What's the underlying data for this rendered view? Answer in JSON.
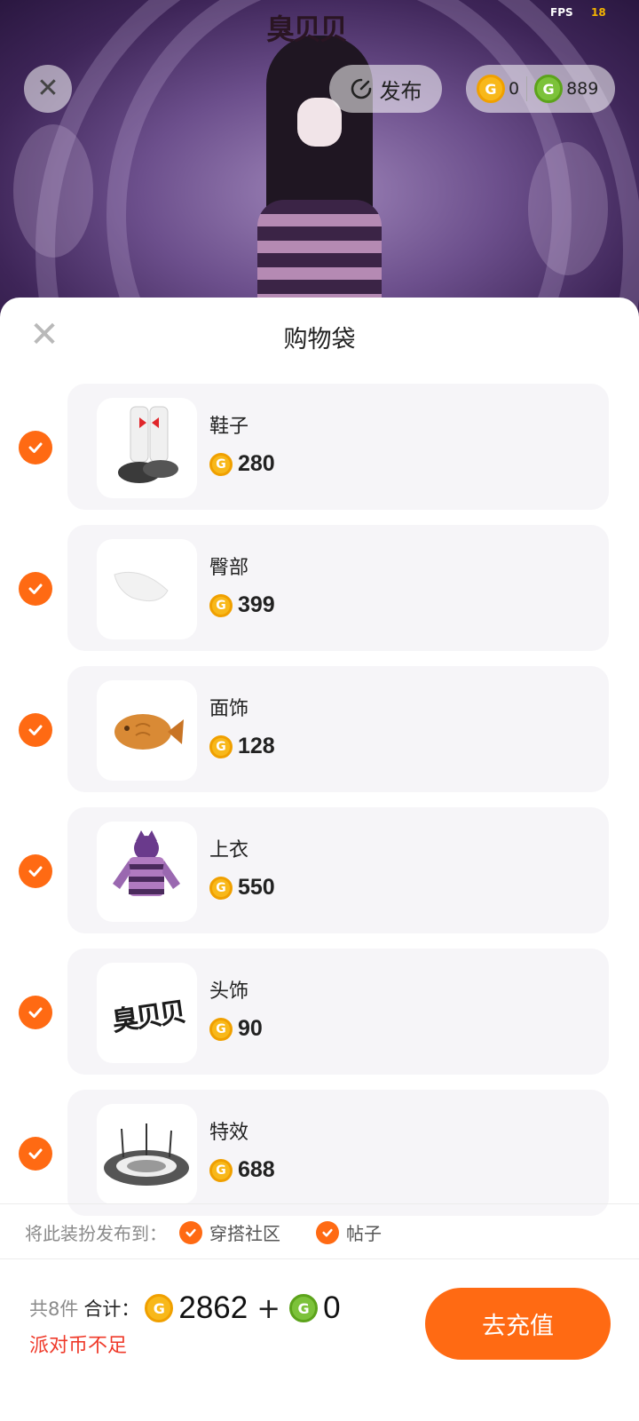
{
  "scene": {
    "logo_text": "臭贝贝",
    "fps_label": "FPS",
    "fps_value": "18"
  },
  "top_bar": {
    "publish_label": "发布",
    "gold_balance": "0",
    "green_balance": "889"
  },
  "sheet": {
    "title": "购物袋",
    "items": [
      {
        "name": "鞋子",
        "price": "280",
        "thumb": "shoes-thumb",
        "checked": true
      },
      {
        "name": "臀部",
        "price": "399",
        "thumb": "hip-thumb",
        "checked": true
      },
      {
        "name": "面饰",
        "price": "128",
        "thumb": "taiyaki-thumb",
        "checked": true
      },
      {
        "name": "上衣",
        "price": "550",
        "thumb": "jacket-thumb",
        "checked": true
      },
      {
        "name": "头饰",
        "price": "90",
        "thumb": "text-headwear-thumb",
        "checked": true
      },
      {
        "name": "特效",
        "price": "688",
        "thumb": "effect-thumb",
        "checked": true
      }
    ],
    "publish_to_label": "将此装扮发布到：",
    "publish_options": [
      "穿搭社区",
      "帖子"
    ]
  },
  "footer": {
    "count": "共8件",
    "total_label": "合计：",
    "gold_total": "2862",
    "plus": "+",
    "green_total": "0",
    "warning": "派对币不足",
    "recharge_label": "去充值"
  },
  "colors": {
    "accent": "#ff6a13",
    "warning": "#ef3a2a",
    "gold_coin": "#f8b81a",
    "green_coin": "#7cc23a"
  }
}
